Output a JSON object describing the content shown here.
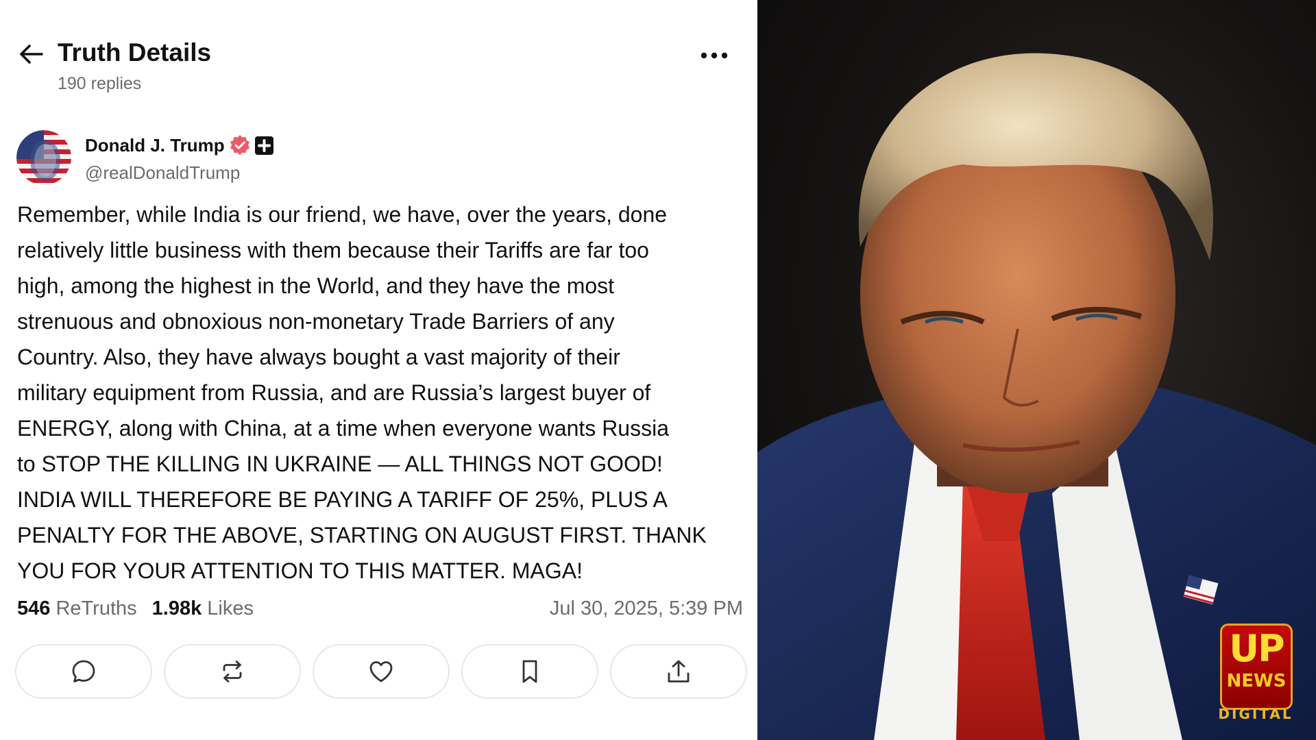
{
  "header": {
    "title": "Truth Details",
    "replies": "190 replies"
  },
  "author": {
    "name": "Donald J. Trump",
    "handle": "@realDonaldTrump"
  },
  "post": {
    "lines": [
      "Remember, while India is our friend, we have, over the years, done",
      "relatively little business with them because their Tariffs are far too",
      "high, among the highest in the World, and they have the most",
      "strenuous and obnoxious non-monetary Trade Barriers of any",
      "Country. Also, they have always bought a vast majority of their",
      "military equipment from Russia, and are Russia’s largest buyer of",
      "ENERGY, along with China, at a time when everyone wants Russia",
      "to STOP THE KILLING IN UKRAINE — ALL THINGS NOT GOOD!",
      "INDIA WILL THEREFORE BE PAYING A TARIFF OF 25%, PLUS A",
      "PENALTY FOR THE ABOVE, STARTING ON AUGUST FIRST. THANK",
      "YOU FOR YOUR ATTENTION TO THIS MATTER. MAGA!"
    ]
  },
  "stats": {
    "retruths_count": "546",
    "retruths_label": "ReTruths",
    "likes_count": "1.98k",
    "likes_label": "Likes",
    "timestamp": "Jul 30, 2025, 5:39 PM"
  },
  "actions": [
    {
      "icon": "reply-icon"
    },
    {
      "icon": "retruth-icon"
    },
    {
      "icon": "heart-icon"
    },
    {
      "icon": "bookmark-icon"
    },
    {
      "icon": "share-icon"
    }
  ],
  "logo": {
    "up": "UP",
    "news": "NEWS",
    "digital": "DIGITAL"
  },
  "colors": {
    "verified": "#ef5a67",
    "muted_text": "#6b6b6b",
    "logo_red": "#c40a0a",
    "logo_gold": "#f2b61e"
  }
}
